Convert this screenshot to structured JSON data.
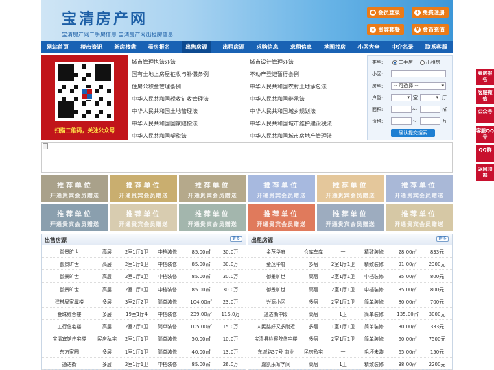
{
  "site": {
    "logo": "宝清房产网",
    "slogan": "宝清房产网二手房信息   宝清房产网出租房信息"
  },
  "header_buttons": [
    {
      "label": "会员登录",
      "icon": "user-icon"
    },
    {
      "label": "免费注册",
      "icon": "user-add-icon"
    },
    {
      "label": "贵宾套餐",
      "icon": "vip-icon"
    },
    {
      "label": "金币充值",
      "icon": "coin-icon"
    }
  ],
  "nav": [
    "网站首页",
    "楼市资讯",
    "新房楼盘",
    "看房报名",
    "出售房源",
    "出租房源",
    "求购信息",
    "求租信息",
    "地图找房",
    "小区大全",
    "中介名录",
    "联系客服"
  ],
  "qr": {
    "caption": "扫描二维码，关注公众号"
  },
  "laws_left": [
    "城市管理执法办法",
    "国有土地上房屋征收与补偿条例",
    "住房公积金管理条例",
    "中华人民共和国税收征收管理法",
    "中华人民共和国土地管理法",
    "中华人民共和国国家赔偿法",
    "中华人民共和国契税法"
  ],
  "laws_right": [
    "城市设计管理办法",
    "不动产登记暂行条例",
    "中华人民共和国农村土地承包法",
    "中华人民共和国继承法",
    "中华人民共和国城乡规划法",
    "中华人民共和国城市维护建设税法",
    "中华人民共和国城市房地产管理法"
  ],
  "search": {
    "type_label": "类型:",
    "type_options": [
      "二手房",
      "出租房"
    ],
    "community_label": "小区:",
    "house_type_label": "房型:",
    "house_type_value": "-- 可选择 --",
    "layout_label": "户型:",
    "room_unit": "室",
    "hall_unit": "厅",
    "area_label": "面积:",
    "area_sep": "〜",
    "area_unit": "㎡",
    "price_label": "价格:",
    "price_sep": "〜",
    "price_unit": "万",
    "submit": "确认提交搜索"
  },
  "ad_slot": {
    "title": "推荐单位",
    "subtitle": "开通贵宾会员赠送",
    "colors": [
      "#a9a18a",
      "#c9ae6f",
      "#b5a98b",
      "#a7b9df",
      "#e4c79b",
      "#a9b8d7",
      "#8a9fae",
      "#d8ccb0",
      "#a3b6ad",
      "#e07a5c",
      "#9dacbf",
      "#d6c8a5"
    ]
  },
  "sale": {
    "title": "出售房源",
    "more": "更多",
    "rows": [
      [
        "御景旷世",
        "高层",
        "2室1厅1卫",
        "中档装修",
        "85.00㎡",
        "30.0万"
      ],
      [
        "御景旷世",
        "高层",
        "2室1厅1卫",
        "中档装修",
        "85.00㎡",
        "30.0万"
      ],
      [
        "御景旷世",
        "高层",
        "2室1厅1卫",
        "中档装修",
        "85.00㎡",
        "30.0万"
      ],
      [
        "御景旷世",
        "高层",
        "2室1厅1卫",
        "中档装修",
        "85.00㎡",
        "30.0万"
      ],
      [
        "建材局家属楼",
        "多层",
        "3室2厅2卫",
        "简单装修",
        "104.00㎡",
        "23.0万"
      ],
      [
        "金珠综合楼",
        "多层",
        "19室1厅4",
        "中档装修",
        "239.00㎡",
        "115.0万"
      ],
      [
        "工行住宅楼",
        "高层",
        "2室2厅1卫",
        "简单装修",
        "105.00㎡",
        "15.0万"
      ],
      [
        "宝清宾馆住宅楼",
        "民房私宅",
        "2室1厅1卫",
        "简单装修",
        "50.00㎡",
        "10.0万"
      ],
      [
        "东方家园",
        "多层",
        "1室1厅1卫",
        "简单装修",
        "40.00㎡",
        "13.0万"
      ],
      [
        "通达街",
        "多层",
        "2室1厅1卫",
        "中档装修",
        "85.00㎡",
        "26.0万"
      ]
    ]
  },
  "rent": {
    "title": "出租房源",
    "more": "更多",
    "rows": [
      [
        "金茂华府",
        "仓库车库",
        "一",
        "精致装修",
        "28.00㎡",
        "833元"
      ],
      [
        "金茂华府",
        "多层",
        "2室1厅1卫",
        "精致装修",
        "91.00㎡",
        "2300元"
      ],
      [
        "御景旷世",
        "高层",
        "2室1厅1卫",
        "中档装修",
        "85.00㎡",
        "800元"
      ],
      [
        "御景旷世",
        "高层",
        "2室1厅1卫",
        "中档装修",
        "85.00㎡",
        "800元"
      ],
      [
        "兴源小区",
        "多层",
        "2室1厅1卫",
        "简单装修",
        "80.00㎡",
        "700元"
      ],
      [
        "通达街中段",
        "高层",
        "1卫",
        "简单装修",
        "135.00㎡",
        "3000元"
      ],
      [
        "人民路好又多附近",
        "多层",
        "1室1厅1卫",
        "简单装修",
        "30.00㎡",
        "333元"
      ],
      [
        "宝清县检察院住宅楼",
        "多层",
        "2室1厅1卫",
        "简单装修",
        "60.00㎡",
        "7500元"
      ],
      [
        "东城路37号 南业",
        "民房私宅",
        "一",
        "毛坯未装",
        "65.00㎡",
        "150元"
      ],
      [
        "嘉凯乐写字间",
        "高层",
        "1卫",
        "精致装修",
        "38.00㎡",
        "2200元"
      ]
    ]
  },
  "sidebar": [
    "看房报名",
    "客服微信",
    "公众号",
    "客服QQ号",
    "QQ群",
    "返回顶部"
  ]
}
